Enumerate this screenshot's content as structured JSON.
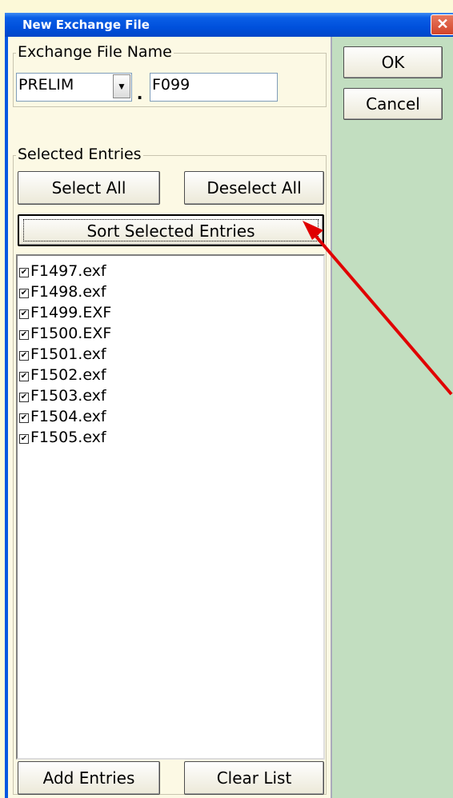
{
  "window": {
    "title": "New Exchange File",
    "close_glyph": "✕"
  },
  "exchange_group": {
    "legend": "Exchange File Name",
    "combo_value": "PRELIM",
    "dot": ".",
    "extension_value": "F099"
  },
  "entries_group": {
    "legend": "Selected Entries",
    "select_all": "Select All",
    "deselect_all": "Deselect All",
    "sort": "Sort Selected Entries",
    "items": [
      "F1497.exf",
      "F1498.exf",
      "F1499.EXF",
      "F1500.EXF",
      "F1501.exf",
      "F1502.exf",
      "F1503.exf",
      "F1504.exf",
      "F1505.exf"
    ],
    "add_entries": "Add Entries",
    "clear_list": "Clear List"
  },
  "actions": {
    "ok": "OK",
    "cancel": "Cancel"
  },
  "colors": {
    "arrow": "#e00000",
    "titlebar": "#0050dc",
    "right_pane": "#c2dec0"
  }
}
